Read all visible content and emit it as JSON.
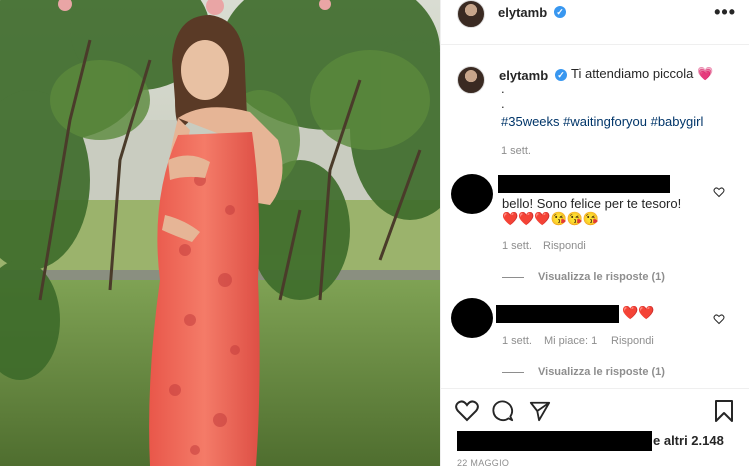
{
  "post": {
    "username": "elytamb",
    "more": "•••"
  },
  "caption": {
    "username": "elytamb",
    "text": "Ti attendiamo piccola 💗",
    "dot1": ".",
    "dot2": ".",
    "hashtags": "#35weeks #waitingforyou #babygirl",
    "time": "1 sett."
  },
  "comments": [
    {
      "text": "bello! Sono felice per te tesoro!",
      "emojis": "❤️❤️❤️😘😘😘",
      "time": "1 sett.",
      "reply": "Rispondi",
      "view_replies": "Visualizza le risposte (1)"
    },
    {
      "text": "❤️❤️",
      "time": "1 sett.",
      "likes": "Mi piace: 1",
      "reply": "Rispondi",
      "view_replies": "Visualizza le risposte (1)"
    }
  ],
  "likes_suffix": "e altri 2.148",
  "date": "22 MAGGIO",
  "colors": {
    "hashtag": "#003569",
    "verified": "#3897f0",
    "muted": "#8e8e8e",
    "dress": "#f06a5a"
  }
}
